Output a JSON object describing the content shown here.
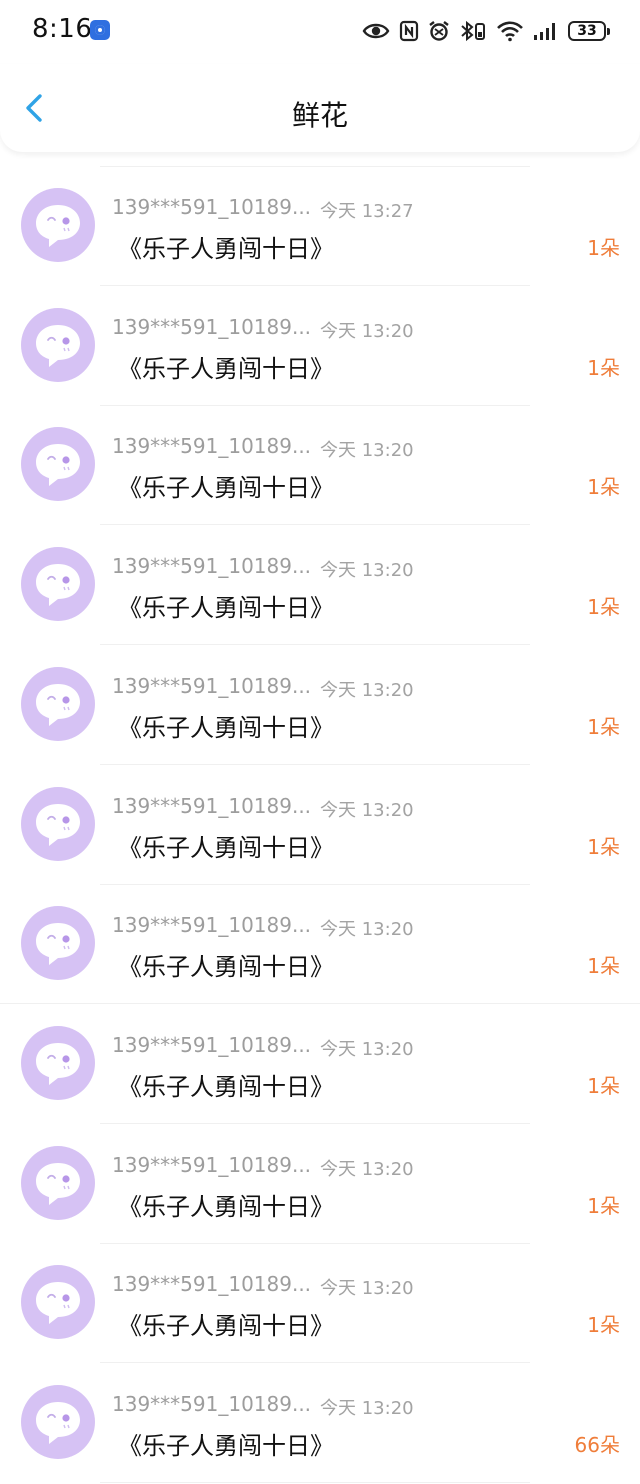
{
  "status_bar": {
    "time": "8:16",
    "battery": "33",
    "icons": [
      "app-badge-icon",
      "eye-icon",
      "nfc-icon",
      "alarm-icon",
      "bluetooth-icon",
      "wifi-icon",
      "signal-icon",
      "battery-icon"
    ]
  },
  "header": {
    "title": "鲜花",
    "back_icon": "chevron-left-icon"
  },
  "colors": {
    "accent_back": "#2fa3e6",
    "avatar_bg": "#d6c2f4",
    "count": "#ef7d3a",
    "meta_text": "#9d9d9d"
  },
  "gifts": [
    {
      "user": "139***591_10189...",
      "time": "今天 13:27",
      "book": "《乐子人勇闯十日》",
      "count": "1朵"
    },
    {
      "user": "139***591_10189...",
      "time": "今天 13:20",
      "book": "《乐子人勇闯十日》",
      "count": "1朵"
    },
    {
      "user": "139***591_10189...",
      "time": "今天 13:20",
      "book": "《乐子人勇闯十日》",
      "count": "1朵"
    },
    {
      "user": "139***591_10189...",
      "time": "今天 13:20",
      "book": "《乐子人勇闯十日》",
      "count": "1朵"
    },
    {
      "user": "139***591_10189...",
      "time": "今天 13:20",
      "book": "《乐子人勇闯十日》",
      "count": "1朵"
    },
    {
      "user": "139***591_10189...",
      "time": "今天 13:20",
      "book": "《乐子人勇闯十日》",
      "count": "1朵"
    },
    {
      "user": "139***591_10189...",
      "time": "今天 13:20",
      "book": "《乐子人勇闯十日》",
      "count": "1朵"
    },
    {
      "user": "139***591_10189...",
      "time": "今天 13:20",
      "book": "《乐子人勇闯十日》",
      "count": "1朵"
    },
    {
      "user": "139***591_10189...",
      "time": "今天 13:20",
      "book": "《乐子人勇闯十日》",
      "count": "1朵"
    },
    {
      "user": "139***591_10189...",
      "time": "今天 13:20",
      "book": "《乐子人勇闯十日》",
      "count": "1朵"
    },
    {
      "user": "139***591_10189...",
      "time": "今天 13:20",
      "book": "《乐子人勇闯十日》",
      "count": "66朵"
    }
  ]
}
